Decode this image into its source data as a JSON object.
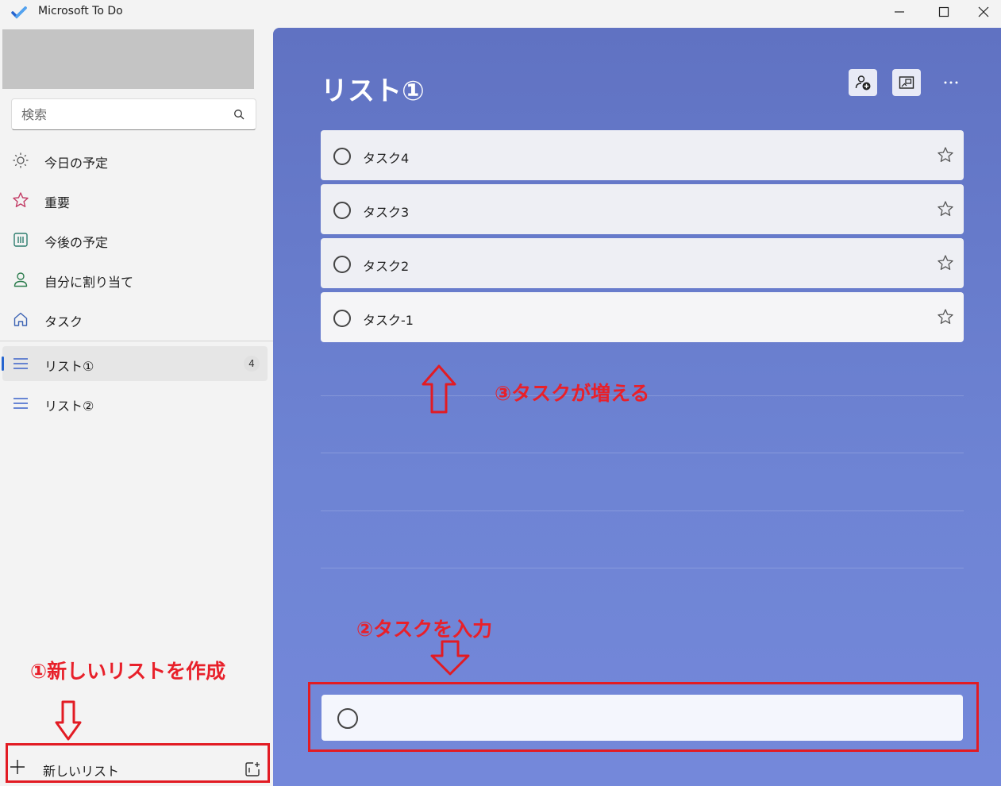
{
  "app": {
    "title": "Microsoft To Do"
  },
  "sidebar": {
    "search_placeholder": "検索",
    "nav_items": [
      {
        "label": "今日の予定",
        "icon": "sun-icon"
      },
      {
        "label": "重要",
        "icon": "star-icon"
      },
      {
        "label": "今後の予定",
        "icon": "calendar-grid-icon"
      },
      {
        "label": "自分に割り当て",
        "icon": "person-icon"
      },
      {
        "label": "タスク",
        "icon": "home-icon"
      }
    ],
    "lists": [
      {
        "label": "リスト①",
        "count": "4",
        "active": true
      },
      {
        "label": "リスト②",
        "count": "",
        "active": false
      }
    ],
    "new_list_label": "新しいリスト"
  },
  "main": {
    "list_title": "リスト①",
    "tasks": [
      {
        "title": "タスク4"
      },
      {
        "title": "タスク3"
      },
      {
        "title": "タスク2"
      },
      {
        "title": "タスク-1"
      }
    ],
    "add_task_placeholder": ""
  },
  "annotations": {
    "step1": "①新しいリストを作成",
    "step2": "②タスクを入力",
    "step3": "③タスクが増える",
    "color": "#e8202a"
  },
  "colors": {
    "accent": "#2564cf",
    "main_bg_top": "#6072c2",
    "main_bg_bottom": "#7488da",
    "sidebar_bg": "#f3f3f3"
  }
}
